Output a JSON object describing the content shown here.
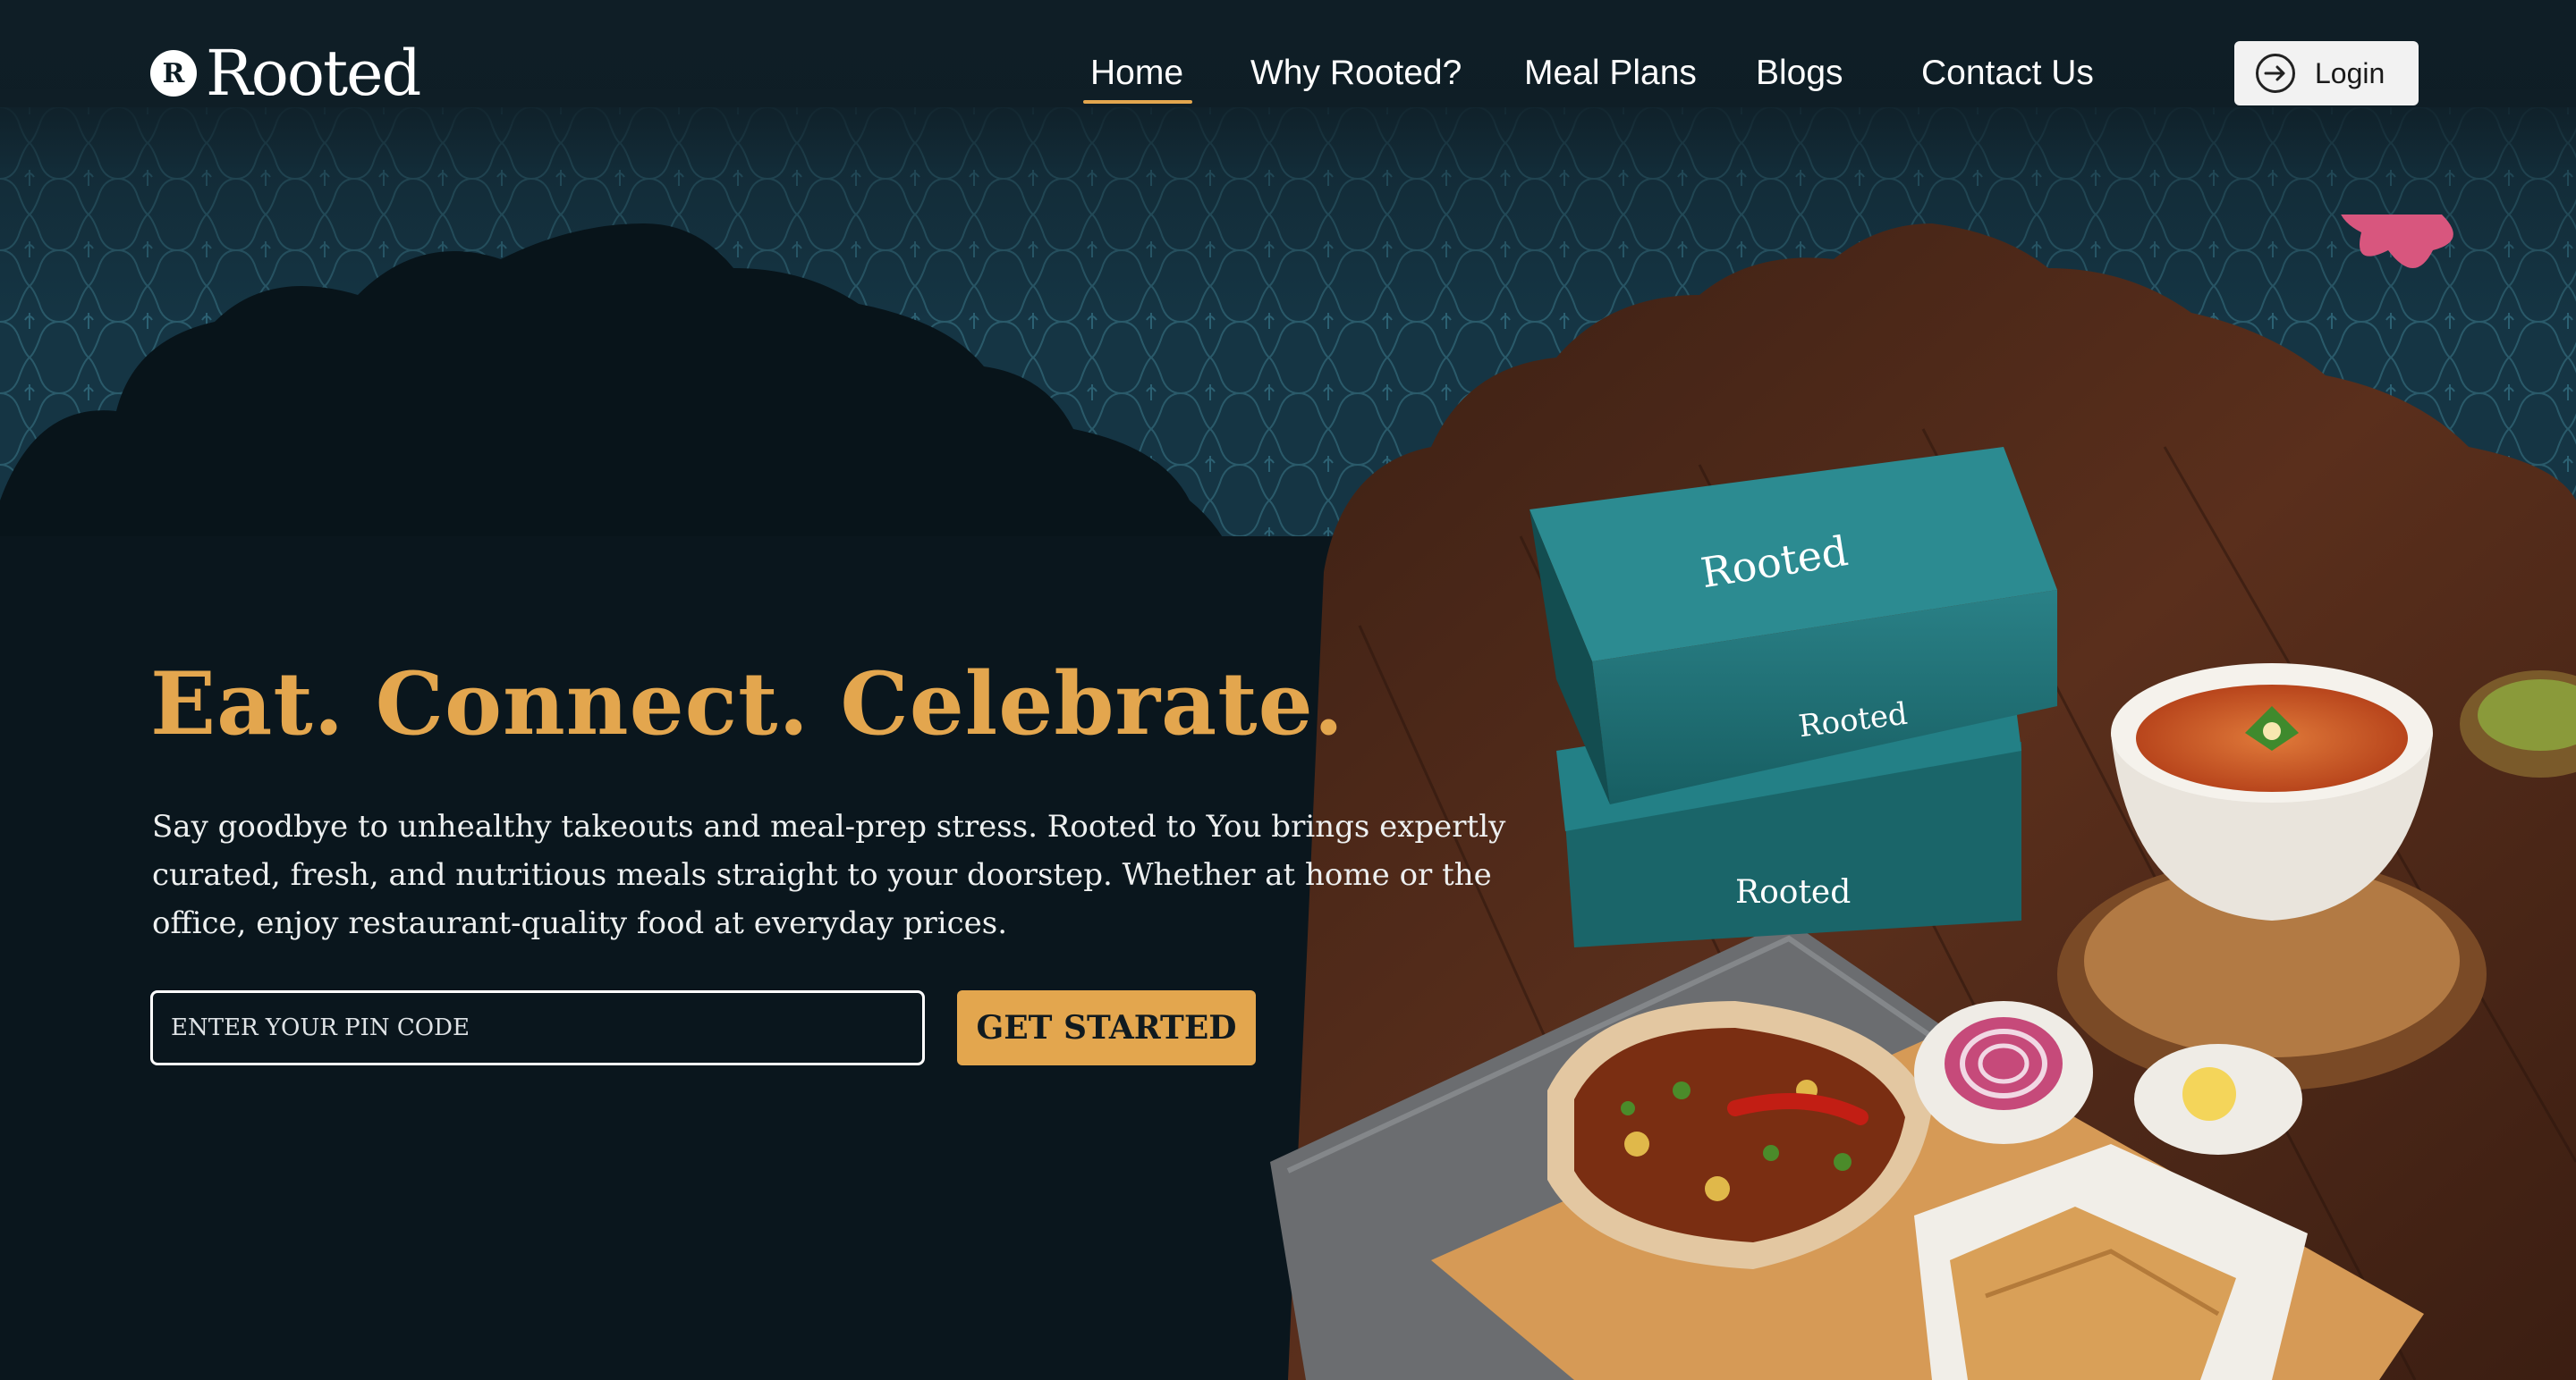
{
  "brand": {
    "name": "Rooted",
    "mark": "R"
  },
  "nav": {
    "items": [
      {
        "label": "Home",
        "active": true
      },
      {
        "label": "Why Rooted?",
        "active": false
      },
      {
        "label": "Meal Plans",
        "active": false
      },
      {
        "label": "Blogs",
        "active": false
      },
      {
        "label": "Contact Us",
        "active": false
      }
    ],
    "login_label": "Login"
  },
  "hero": {
    "headline": "Eat. Connect. Celebrate.",
    "description": "Say goodbye to unhealthy takeouts and meal-prep stress. Rooted to You brings expertly curated, fresh, and nutritious meals straight to your doorstep. Whether at home or the office, enjoy restaurant-quality food at everyday prices.",
    "pin_placeholder": "ENTER YOUR PIN CODE",
    "cta_label": "GET STARTED"
  },
  "food_box_labels": [
    "Rooted",
    "Rooted",
    "Rooted"
  ],
  "colors": {
    "accent": "#e3a64e",
    "background": "#0b1a22",
    "pattern": "#1c4252",
    "box_teal": "#1e6e72",
    "login_bg": "#f2f2f2"
  },
  "icons": {
    "login": "arrow-right-circle-icon",
    "logo": "rooted-logo-icon"
  }
}
